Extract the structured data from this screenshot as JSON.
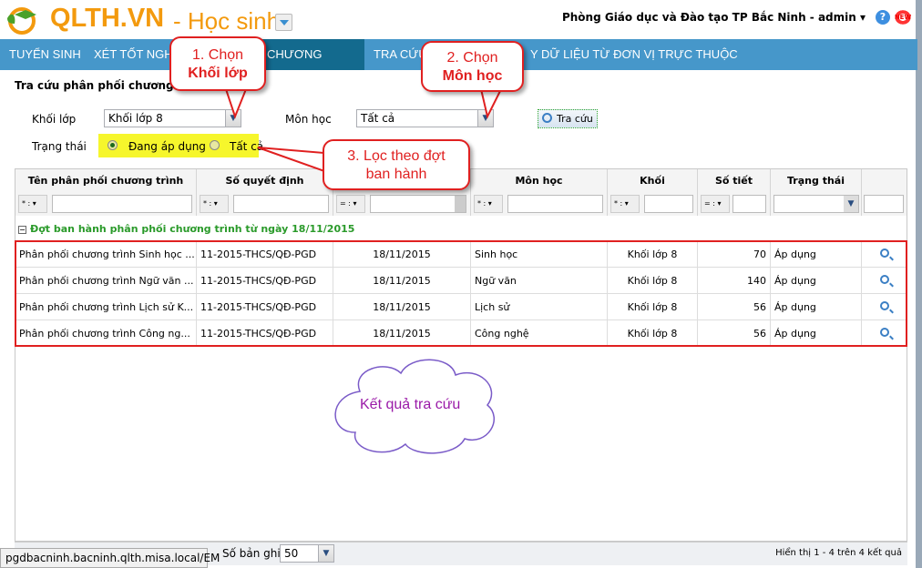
{
  "header": {
    "brand": "QLTH.VN",
    "module": "- Học sinh",
    "user": "Phòng Giáo dục và Đào tạo TP Bắc Ninh - admin ▾",
    "help": "?",
    "new_badge": "NEW"
  },
  "nav": [
    "TUYỂN SINH",
    "XÉT TỐT NGH",
    "CHƯƠNG TRÌNH",
    "TRA CỨU",
    "Y DỮ LIỆU TỪ ĐƠN VỊ TRỰC THUỘC"
  ],
  "page_title": "Tra cứu phân phối chương t",
  "filters": {
    "khoi_label": "Khối lớp",
    "khoi_value": "Khối lớp 8",
    "mon_label": "Môn học",
    "mon_value": "Tất cả",
    "search_button": "Tra cứu",
    "status_label": "Trạng thái",
    "radio_active": "Đang áp dụng",
    "radio_all": "Tất cả"
  },
  "columns": [
    "Tên phân phối chương trình",
    "Số quyết định",
    "",
    "Môn học",
    "Khối",
    "Số tiết",
    "Trạng thái",
    ""
  ],
  "filter_ops": [
    "* : ▾",
    "* : ▾",
    "= : ▾",
    "* : ▾",
    "* : ▾",
    "= : ▾"
  ],
  "group": "Đợt ban hành phân phối chương trình từ ngày 18/11/2015",
  "rows": [
    {
      "name": "Phân phối chương trình Sinh học ...",
      "decision": "11-2015-THCS/QĐ-PGD",
      "date": "18/11/2015",
      "subject": "Sinh học",
      "grade": "Khối lớp 8",
      "periods": "70",
      "status": "Áp dụng"
    },
    {
      "name": "Phân phối chương trình Ngữ văn ...",
      "decision": "11-2015-THCS/QĐ-PGD",
      "date": "18/11/2015",
      "subject": "Ngữ văn",
      "grade": "Khối lớp 8",
      "periods": "140",
      "status": "Áp dụng"
    },
    {
      "name": "Phân phối chương trình Lịch sử K...",
      "decision": "11-2015-THCS/QĐ-PGD",
      "date": "18/11/2015",
      "subject": "Lịch sử",
      "grade": "Khối lớp 8",
      "periods": "56",
      "status": "Áp dụng"
    },
    {
      "name": "Phân phối chương trình Công ng...",
      "decision": "11-2015-THCS/QĐ-PGD",
      "date": "18/11/2015",
      "subject": "Công nghệ",
      "grade": "Khối lớp 8",
      "periods": "56",
      "status": "Áp dụng"
    }
  ],
  "pager": {
    "page_size_label": "Số bản ghi",
    "page_size": "50",
    "summary": "Hiển thị 1 - 4 trên 4 kết quả"
  },
  "status_bar": "pgdbacninh.bacninh.qlth.misa.local/EM",
  "callouts": {
    "c1_line1": "1. Chọn",
    "c1_line2": "Khối lớp",
    "c2_line1": "2. Chọn",
    "c2_line2": "Môn học",
    "c3_line1": "3. Lọc theo đợt",
    "c3_line2": "ban hành",
    "cloud": "Kết quả tra cứu"
  }
}
